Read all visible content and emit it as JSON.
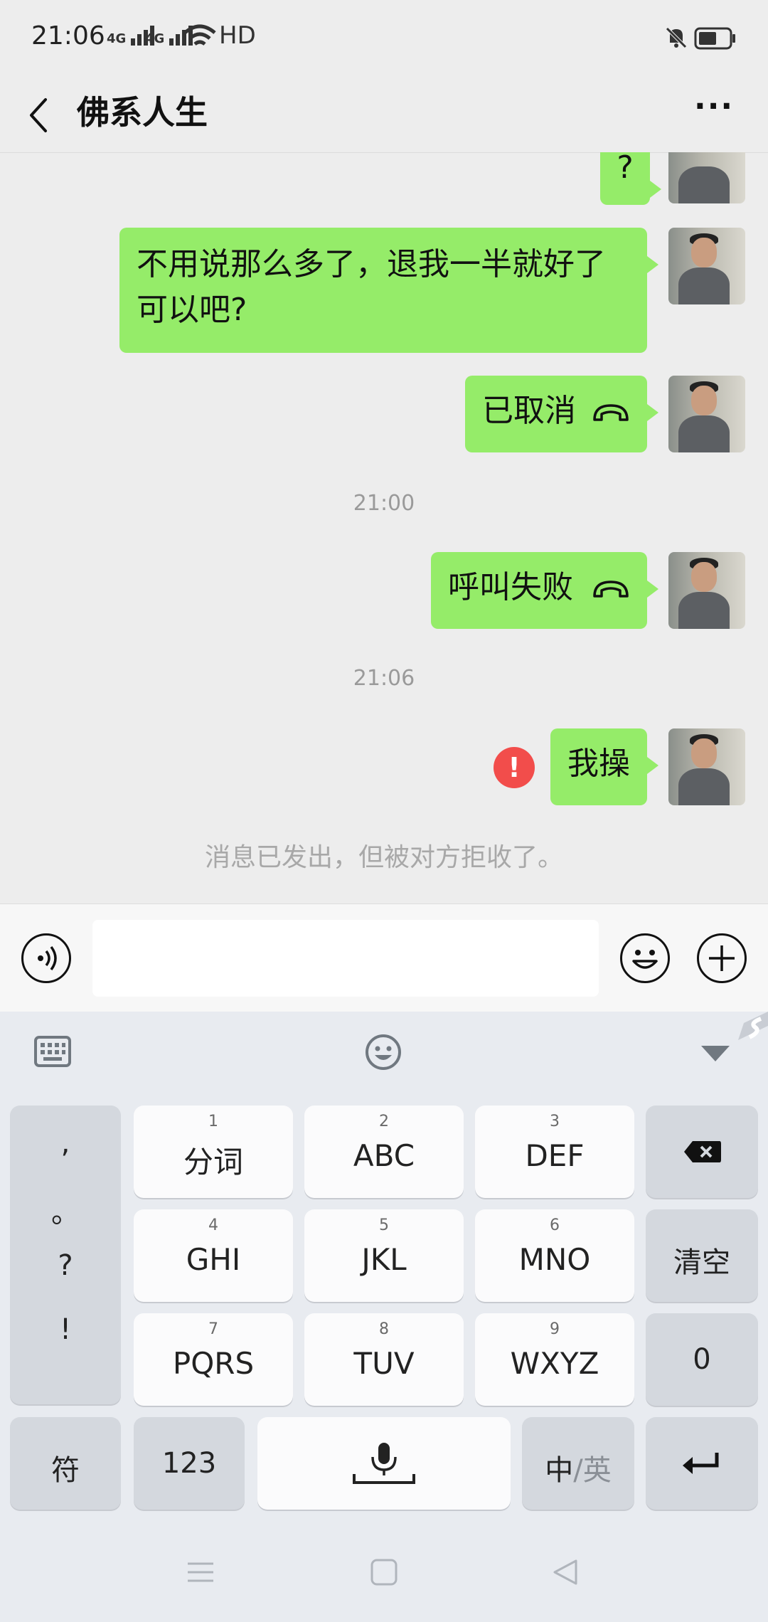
{
  "status_bar": {
    "time": "21:06",
    "sig1": "4G",
    "sig2": "4G",
    "hd": "HD"
  },
  "header": {
    "title": "佛系人生",
    "more": "···"
  },
  "messages": [
    {
      "text": "?",
      "type": "text"
    },
    {
      "text": "不用说那么多了，退我一半就好了可以吧?",
      "line1": "不用说那么多了，退我一半就好了",
      "line2": "可以吧?",
      "type": "text"
    },
    {
      "text": "已取消",
      "type": "call"
    },
    {
      "timestamp": "21:00"
    },
    {
      "text": "呼叫失败",
      "type": "call"
    },
    {
      "timestamp": "21:06"
    },
    {
      "text": "我操",
      "type": "text",
      "failed": true
    }
  ],
  "error_badge": "!",
  "notice": "消息已发出，但被对方拒收了。",
  "input": {
    "value": "",
    "placeholder": ""
  },
  "keyboard": {
    "punct": [
      ",",
      "。",
      "?",
      "!"
    ],
    "keys": [
      {
        "num": "1",
        "label": "分词"
      },
      {
        "num": "2",
        "label": "ABC"
      },
      {
        "num": "3",
        "label": "DEF"
      },
      {
        "num": "4",
        "label": "GHI"
      },
      {
        "num": "5",
        "label": "JKL"
      },
      {
        "num": "6",
        "label": "MNO"
      },
      {
        "num": "7",
        "label": "PQRS"
      },
      {
        "num": "8",
        "label": "TUV"
      },
      {
        "num": "9",
        "label": "WXYZ"
      }
    ],
    "clear": "清空",
    "zero": "0",
    "symbol": "符",
    "numbers": "123",
    "lang_cn": "中",
    "lang_sep": "/",
    "lang_en": "英"
  },
  "colors": {
    "bubble": "#95ec69",
    "background": "#ededed",
    "error": "#f24d4b"
  },
  "icons": [
    "back-icon",
    "more-icon",
    "voice-icon",
    "emoji-icon",
    "plus-icon",
    "keyboard-icon",
    "hide-keyboard-icon",
    "backspace-icon",
    "microphone-icon",
    "enter-icon",
    "missed-call-icon"
  ]
}
